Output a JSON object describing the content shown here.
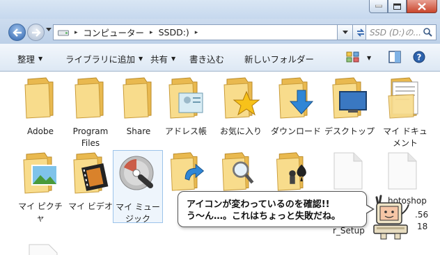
{
  "address": {
    "breadcrumbs": [
      "コンピューター",
      "SSDD:)"
    ],
    "search_placeholder": "SSD (D:)の..."
  },
  "toolbar": {
    "organize": "整理",
    "include_library": "ライブラリに追加",
    "share": "共有",
    "burn": "書き込む",
    "new_folder": "新しいフォルダー"
  },
  "items": [
    {
      "label": "Adobe",
      "icon": "folder-icon"
    },
    {
      "label": "Program Files",
      "icon": "folder-icon"
    },
    {
      "label": "Share",
      "icon": "folder-icon"
    },
    {
      "label": "アドレス帳",
      "icon": "contacts-folder-icon"
    },
    {
      "label": "お気に入り",
      "icon": "favorites-folder-icon"
    },
    {
      "label": "ダウンロード",
      "icon": "downloads-folder-icon"
    },
    {
      "label": "デスクトップ",
      "icon": "desktop-folder-icon"
    },
    {
      "label": "マイ ドキュメント",
      "icon": "documents-folder-icon"
    },
    {
      "label": "マイ ピクチャ",
      "icon": "pictures-folder-icon"
    },
    {
      "label": "マイ ビデオ",
      "icon": "videos-folder-icon"
    },
    {
      "label": "マイ ミュージック",
      "icon": "music-disc-icon"
    }
  ],
  "partial_labels": {
    "right_1": "hotoshop",
    "right_2": ".56",
    "right_3": "18",
    "right_4": "r_Setup"
  },
  "bubble": {
    "line1": "アイコンが変わっているのを確認!!",
    "line2": "う～ん…。これはちょっと失敗だね。"
  },
  "colors": {
    "folder": "#f5d37a",
    "selection": "#9cc3ea",
    "nav_blue": "#2e63ad"
  }
}
